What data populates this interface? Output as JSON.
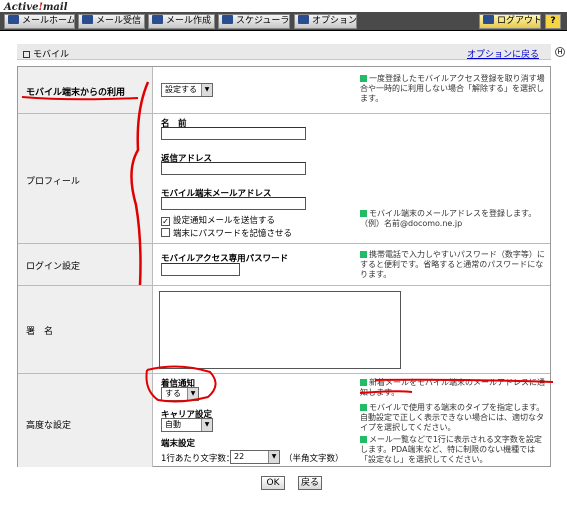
{
  "app": {
    "logo_a": "Active",
    "logo_b": "!",
    "logo_c": "mail"
  },
  "toolbar": {
    "mail_home": "メールホーム",
    "inbox": "メール受信",
    "compose": "メール作成",
    "scheduler": "スケジューラ",
    "options": "オプション",
    "logout": "ログアウト",
    "help": "?"
  },
  "page": {
    "title": "モバイル",
    "back_to_options": "オプションに戻る",
    "help_mark": "H"
  },
  "rows": {
    "use": {
      "label": "モバイル端末からの利用",
      "select": "設定する",
      "hint": "一度登録したモバイルアクセス登録を取り消す場合や一時的に利用しない場合「解除する」を選択します。"
    },
    "profile": {
      "label": "プロフィール",
      "name_label": "名　前",
      "name_value": "",
      "reply_label": "返信アドレス",
      "reply_value": "",
      "mobile_label": "モバイル端末メールアドレス",
      "mobile_value": "",
      "chk_notify": "設定通知メールを送信する",
      "chk_remember": "端末にパスワードを記憶させる",
      "hint": "モバイル端末のメールアドレスを登録します。（例）名前@docomo.ne.jp"
    },
    "login": {
      "label": "ログイン設定",
      "pw_label": "モバイルアクセス専用パスワード",
      "pw_value": "",
      "hint": "携帯電話で入力しやすいパスワード（数字等）にすると便利です。省略すると通常のパスワードになります。"
    },
    "signature": {
      "label": "署　名",
      "value": ""
    },
    "advanced": {
      "label": "高度な設定",
      "notify_label": "着信通知",
      "notify_select": "する",
      "notify_hint": "新着メールをモバイル端末のメールアドレスに通知します。",
      "carrier_label": "キャリア設定",
      "carrier_select": "自動",
      "carrier_hint": "モバイルで使用する端末のタイプを指定します。自動設定で正しく表示できない場合には、適切なタイプを選択してください。",
      "device_label": "端末設定",
      "chars_label": "1行あたり文字数：",
      "chars_select": "22",
      "chars_unit": "（半角文字数）",
      "device_hint": "メール一覧などで1行に表示される文字数を設定します。PDA端末など、特に制限のない機種では「設定なし」を選択してください。"
    }
  },
  "buttons": {
    "ok": "OK",
    "back": "戻る"
  },
  "colors": {
    "toolbar": "#4a4a4a",
    "label_bg": "#efefef",
    "annotation": "#e00000",
    "link": "#0000cc"
  }
}
